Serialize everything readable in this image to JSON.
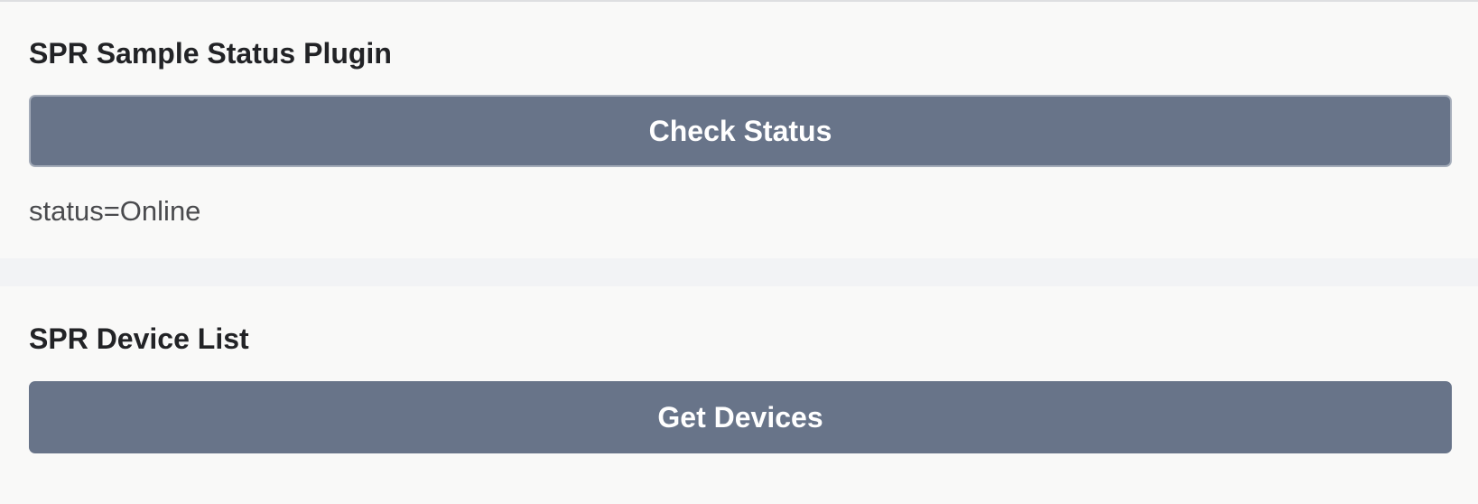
{
  "status_plugin": {
    "title": "SPR Sample Status Plugin",
    "button_label": "Check Status",
    "status_text": "status=Online"
  },
  "device_list": {
    "title": "SPR Device List",
    "button_label": "Get Devices"
  },
  "colors": {
    "button_bg": "#687489",
    "card_bg": "#f9f9f8",
    "page_bg": "#f2f3f5"
  }
}
